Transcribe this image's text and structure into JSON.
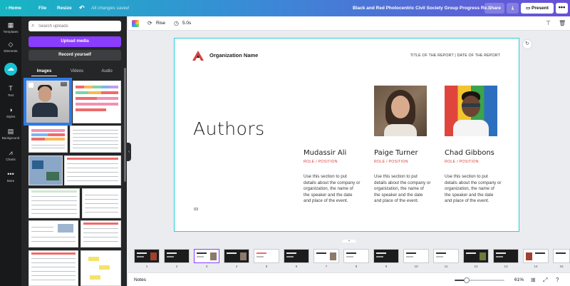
{
  "topbar": {
    "home": "Home",
    "file": "File",
    "resize": "Resize",
    "saved": "All changes saved",
    "doc_title": "Black and Red Photocentric Civil Society Group Progress Re...",
    "share": "Share",
    "present": "Present",
    "more": "•••"
  },
  "rail": {
    "items": [
      {
        "label": "Templates",
        "icon": "templates-icon"
      },
      {
        "label": "Elements",
        "icon": "elements-icon"
      },
      {
        "label": "",
        "icon": "uploads-icon"
      },
      {
        "label": "Text",
        "icon": "text-icon"
      },
      {
        "label": "Styles",
        "icon": "styles-icon"
      },
      {
        "label": "Background",
        "icon": "background-icon"
      },
      {
        "label": "Charts",
        "icon": "charts-icon"
      },
      {
        "label": "More",
        "icon": "more-icon"
      }
    ]
  },
  "panel": {
    "search_placeholder": "Search uploads",
    "upload_label": "Upload media",
    "record_label": "Record yourself",
    "tabs": [
      "Images",
      "Videos",
      "Audio"
    ],
    "active_tab": "Images"
  },
  "toolbar": {
    "animation": "Rise",
    "duration": "5.0s"
  },
  "slide": {
    "org_name": "Organization Name",
    "report_title": "TITLE OF THE REPORT | DATE OF THE REPORT",
    "title": "Authors",
    "page_number": "03",
    "authors": [
      {
        "name": "Mudassir Ali",
        "role": "ROLE / POSITION",
        "desc": "Use this section to put details about the company or organization, the name of the speaker and the date and place of the event."
      },
      {
        "name": "Paige Turner",
        "role": "ROLE / POSITION",
        "desc": "Use this section to put details about the company or organization, the name of the speaker and the date and place of the event."
      },
      {
        "name": "Chad Gibbons",
        "role": "ROLE / POSITION",
        "desc": "Use this section to put details about the company or organization, the name of the speaker and the date and place of the event."
      }
    ],
    "colors": {
      "accent": "#d5403e",
      "selection": "#2ad0d8"
    }
  },
  "pages": {
    "numbers": [
      "1",
      "2",
      "3",
      "4",
      "5",
      "6",
      "7",
      "8",
      "9",
      "10",
      "11",
      "12",
      "13",
      "14"
    ],
    "active": "3",
    "more": "15"
  },
  "footer": {
    "notes": "Notes",
    "zoom": "61%",
    "zoom_fraction": 0.61
  }
}
